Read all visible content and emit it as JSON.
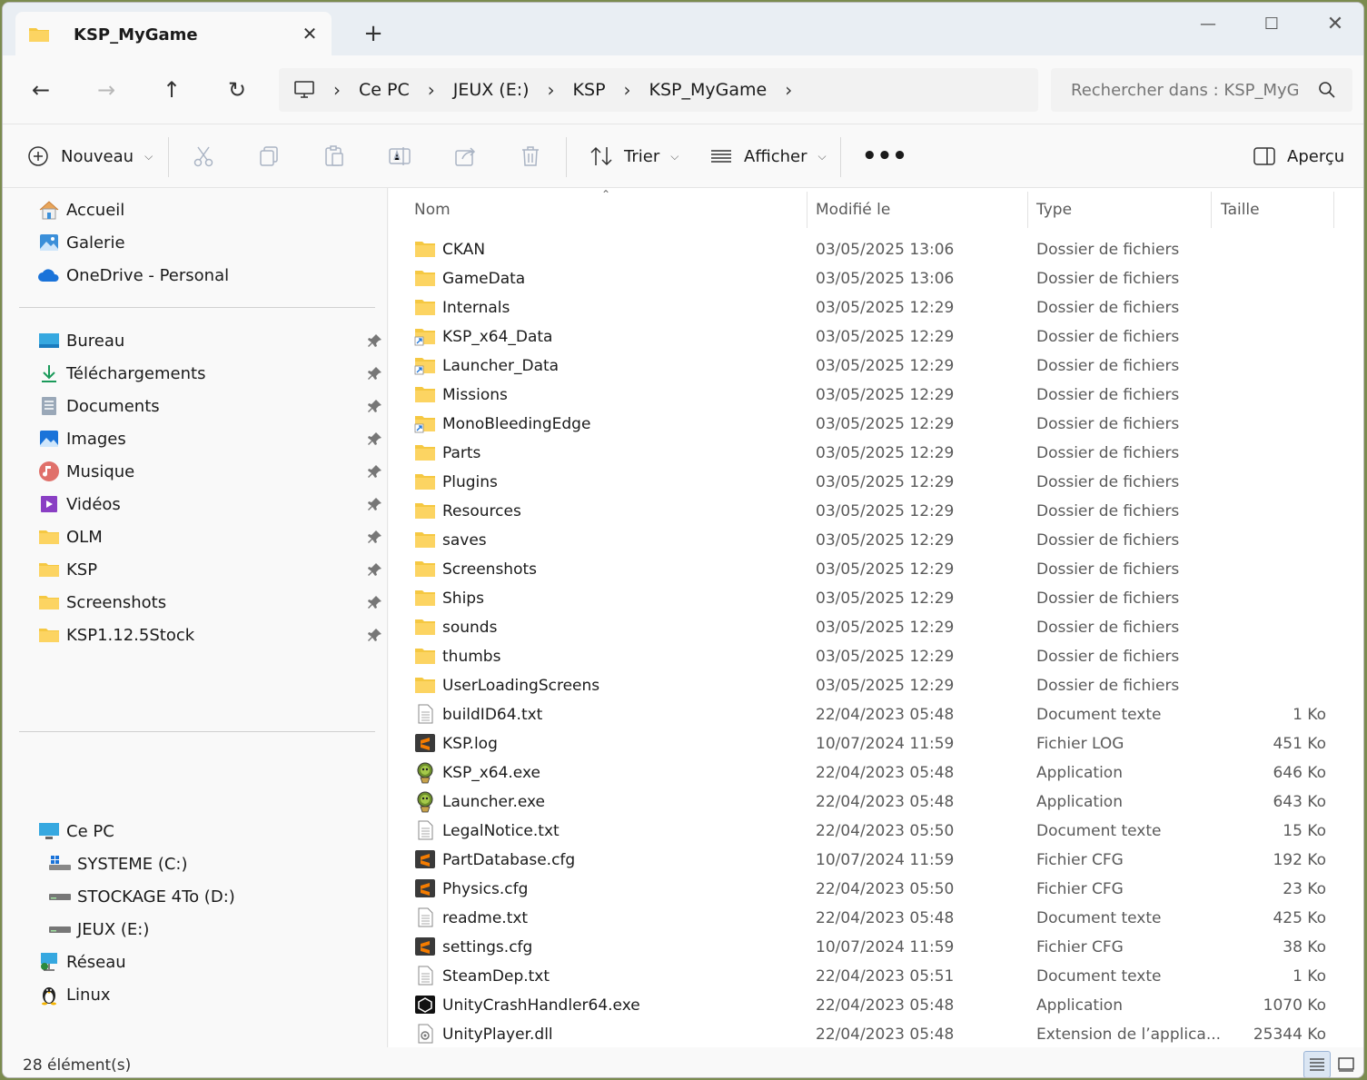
{
  "tab": {
    "title": "KSP_MyGame"
  },
  "address": {
    "crumbs": [
      "Ce PC",
      "JEUX (E:)",
      "KSP",
      "KSP_MyGame"
    ]
  },
  "search": {
    "placeholder": "Rechercher dans : KSP_MyGame"
  },
  "toolbar": {
    "new_label": "Nouveau",
    "sort_label": "Trier",
    "view_label": "Afficher",
    "preview_label": "Aperçu"
  },
  "sidebar": {
    "top": [
      "Accueil",
      "Galerie",
      "OneDrive - Personal"
    ],
    "pinned": [
      "Bureau",
      "Téléchargements",
      "Documents",
      "Images",
      "Musique",
      "Vidéos",
      "OLM",
      "KSP",
      "Screenshots",
      "KSP1.12.5Stock"
    ],
    "this_pc": "Ce PC",
    "drives": [
      "SYSTEME (C:)",
      "STOCKAGE 4To (D:)",
      "JEUX (E:)"
    ],
    "network": "Réseau",
    "linux": "Linux"
  },
  "columns": {
    "name": "Nom",
    "modified": "Modifié le",
    "type": "Type",
    "size": "Taille"
  },
  "files": [
    {
      "name": "CKAN",
      "date": "03/05/2025 13:06",
      "type": "Dossier de fichiers",
      "size": "",
      "icon": "folder-icon"
    },
    {
      "name": "GameData",
      "date": "03/05/2025 13:06",
      "type": "Dossier de fichiers",
      "size": "",
      "icon": "folder-icon"
    },
    {
      "name": "Internals",
      "date": "03/05/2025 12:29",
      "type": "Dossier de fichiers",
      "size": "",
      "icon": "folder-icon"
    },
    {
      "name": "KSP_x64_Data",
      "date": "03/05/2025 12:29",
      "type": "Dossier de fichiers",
      "size": "",
      "icon": "folder-link-icon"
    },
    {
      "name": "Launcher_Data",
      "date": "03/05/2025 12:29",
      "type": "Dossier de fichiers",
      "size": "",
      "icon": "folder-link-icon"
    },
    {
      "name": "Missions",
      "date": "03/05/2025 12:29",
      "type": "Dossier de fichiers",
      "size": "",
      "icon": "folder-icon"
    },
    {
      "name": "MonoBleedingEdge",
      "date": "03/05/2025 12:29",
      "type": "Dossier de fichiers",
      "size": "",
      "icon": "folder-link-icon"
    },
    {
      "name": "Parts",
      "date": "03/05/2025 12:29",
      "type": "Dossier de fichiers",
      "size": "",
      "icon": "folder-icon"
    },
    {
      "name": "Plugins",
      "date": "03/05/2025 12:29",
      "type": "Dossier de fichiers",
      "size": "",
      "icon": "folder-icon"
    },
    {
      "name": "Resources",
      "date": "03/05/2025 12:29",
      "type": "Dossier de fichiers",
      "size": "",
      "icon": "folder-icon"
    },
    {
      "name": "saves",
      "date": "03/05/2025 12:29",
      "type": "Dossier de fichiers",
      "size": "",
      "icon": "folder-icon"
    },
    {
      "name": "Screenshots",
      "date": "03/05/2025 12:29",
      "type": "Dossier de fichiers",
      "size": "",
      "icon": "folder-icon"
    },
    {
      "name": "Ships",
      "date": "03/05/2025 12:29",
      "type": "Dossier de fichiers",
      "size": "",
      "icon": "folder-icon"
    },
    {
      "name": "sounds",
      "date": "03/05/2025 12:29",
      "type": "Dossier de fichiers",
      "size": "",
      "icon": "folder-icon"
    },
    {
      "name": "thumbs",
      "date": "03/05/2025 12:29",
      "type": "Dossier de fichiers",
      "size": "",
      "icon": "folder-icon"
    },
    {
      "name": "UserLoadingScreens",
      "date": "03/05/2025 12:29",
      "type": "Dossier de fichiers",
      "size": "",
      "icon": "folder-icon"
    },
    {
      "name": "buildID64.txt",
      "date": "22/04/2023 05:48",
      "type": "Document texte",
      "size": "1 Ko",
      "icon": "text-file-icon"
    },
    {
      "name": "KSP.log",
      "date": "10/07/2024 11:59",
      "type": "Fichier LOG",
      "size": "451 Ko",
      "icon": "sublime-file-icon"
    },
    {
      "name": "KSP_x64.exe",
      "date": "22/04/2023 05:48",
      "type": "Application",
      "size": "646 Ko",
      "icon": "kerbal-app-icon"
    },
    {
      "name": "Launcher.exe",
      "date": "22/04/2023 05:48",
      "type": "Application",
      "size": "643 Ko",
      "icon": "kerbal-app-icon"
    },
    {
      "name": "LegalNotice.txt",
      "date": "22/04/2023 05:50",
      "type": "Document texte",
      "size": "15 Ko",
      "icon": "text-file-icon"
    },
    {
      "name": "PartDatabase.cfg",
      "date": "10/07/2024 11:59",
      "type": "Fichier CFG",
      "size": "192 Ko",
      "icon": "sublime-file-icon"
    },
    {
      "name": "Physics.cfg",
      "date": "22/04/2023 05:50",
      "type": "Fichier CFG",
      "size": "23 Ko",
      "icon": "sublime-file-icon"
    },
    {
      "name": "readme.txt",
      "date": "22/04/2023 05:48",
      "type": "Document texte",
      "size": "425 Ko",
      "icon": "text-file-icon"
    },
    {
      "name": "settings.cfg",
      "date": "10/07/2024 11:59",
      "type": "Fichier CFG",
      "size": "38 Ko",
      "icon": "sublime-file-icon"
    },
    {
      "name": "SteamDep.txt",
      "date": "22/04/2023 05:51",
      "type": "Document texte",
      "size": "1 Ko",
      "icon": "text-file-icon"
    },
    {
      "name": "UnityCrashHandler64.exe",
      "date": "22/04/2023 05:48",
      "type": "Application",
      "size": "1070 Ko",
      "icon": "unity-app-icon"
    },
    {
      "name": "UnityPlayer.dll",
      "date": "22/04/2023 05:48",
      "type": "Extension de l’applica...",
      "size": "25344 Ko",
      "icon": "dll-file-icon"
    }
  ],
  "status": {
    "count": "28 élément(s)"
  },
  "colors": {
    "folder": "#f5c842",
    "accent": "#0067c0",
    "sublime": "#f57c00"
  }
}
